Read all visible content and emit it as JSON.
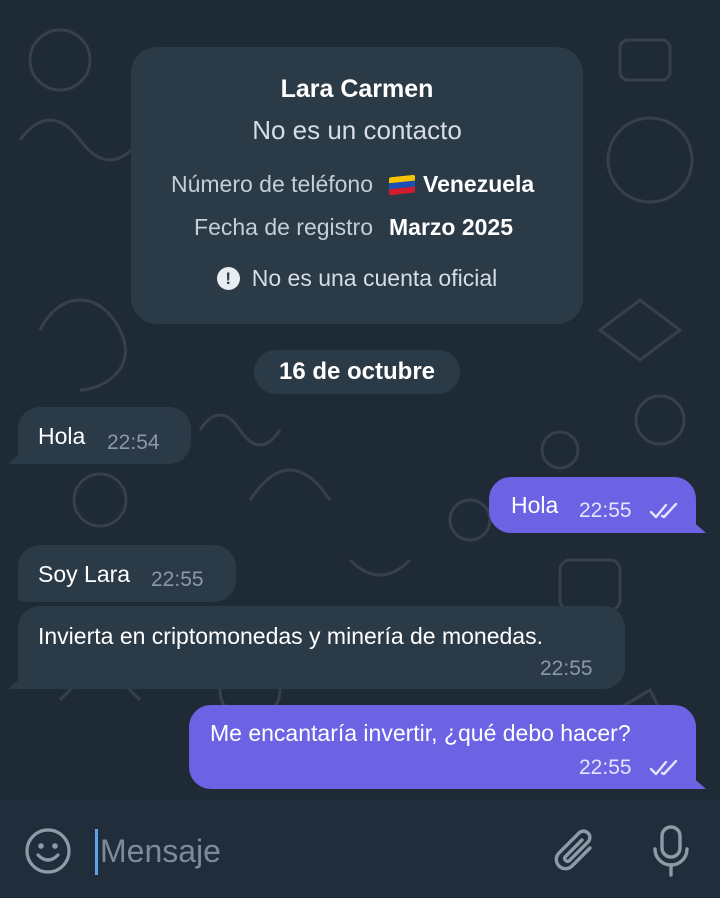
{
  "contact_card": {
    "name": "Lara Carmen",
    "subtitle": "No es un contacto",
    "phone_label": "Número de teléfono",
    "phone_value": "Venezuela",
    "registration_label": "Fecha de registro",
    "registration_value": "Marzo 2025",
    "warning": "No es una cuenta oficial",
    "warning_icon": "info-exclamation-icon",
    "flag_icon": "venezuela-flag-icon"
  },
  "date_separator": "16 de octubre",
  "messages": [
    {
      "direction": "in",
      "text": "Hola",
      "time": "22:54"
    },
    {
      "direction": "out",
      "text": "Hola",
      "time": "22:55",
      "status": "read"
    },
    {
      "direction": "in",
      "text": "Soy Lara",
      "time": "22:55"
    },
    {
      "direction": "in",
      "text": "Invierta en criptomonedas y minería de monedas.",
      "time": "22:55"
    },
    {
      "direction": "out",
      "text": "Me encantaría invertir, ¿qué debo hacer?",
      "time": "22:55",
      "status": "read"
    }
  ],
  "composer": {
    "placeholder": "Mensaje",
    "emoji_icon": "emoji-icon",
    "attach_icon": "paperclip-icon",
    "mic_icon": "microphone-icon"
  },
  "colors": {
    "background": "#1e2a36",
    "incoming_bubble": "#2b3a47",
    "outgoing_bubble": "#6b63e4",
    "input_bar": "#212d3b",
    "cursor": "#5fa2e8"
  }
}
